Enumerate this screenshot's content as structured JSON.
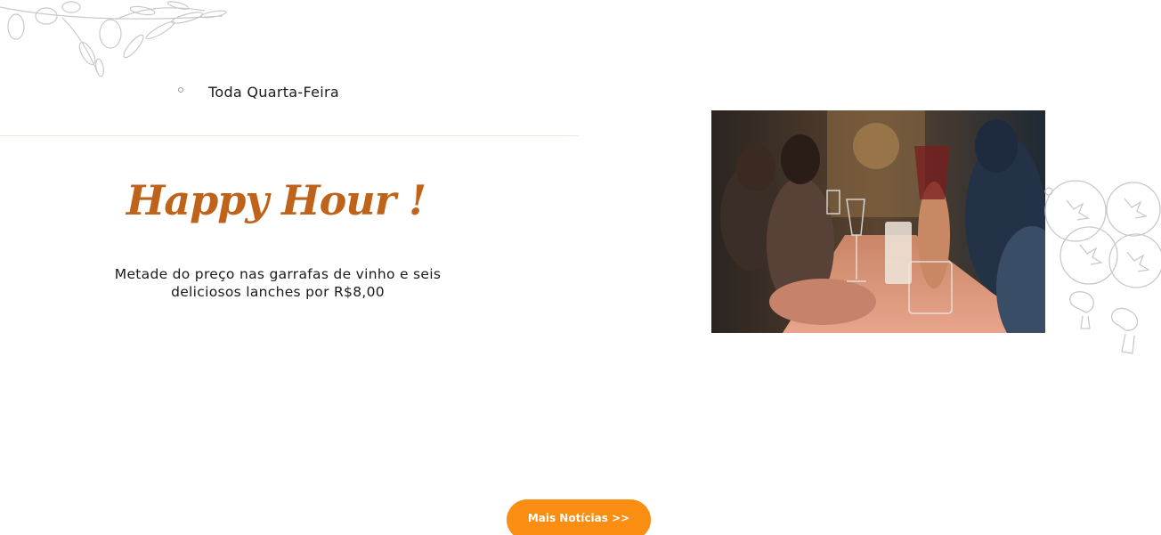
{
  "event": {
    "schedule": "Toda Quarta-Feira",
    "title": "Happy Hour !",
    "description": "Metade do preço nas garrafas de vinho e seis deliciosos lanches por R$8,00"
  },
  "actions": {
    "more_news_label": "Mais Notícias >>"
  },
  "colors": {
    "title": "#c0631a",
    "button": "#f98e12",
    "divider": "#f1e6d4",
    "sketch": "#c9c9c9"
  },
  "images": {
    "photo": "restaurant-wine-table-photo",
    "top_left_decoration": "olive-branch-sketch",
    "right_decoration": "tomato-mushroom-sketch"
  }
}
